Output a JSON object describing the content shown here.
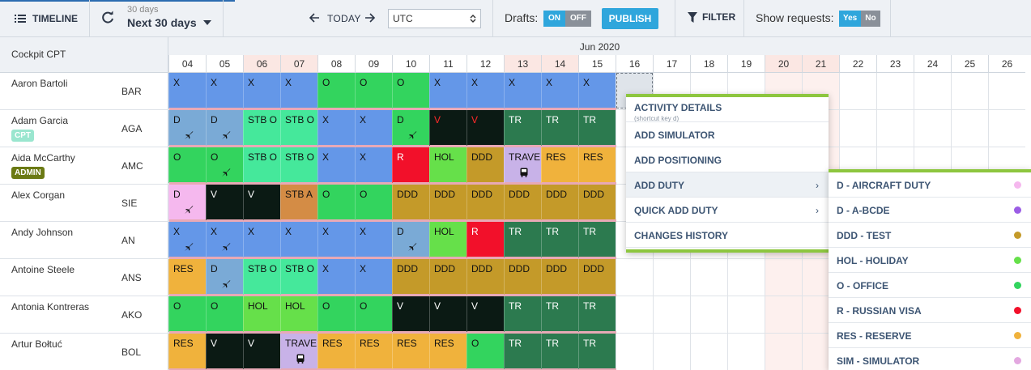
{
  "toolbar": {
    "timeline_label": "TIMELINE",
    "range_small": "30 days",
    "range_main": "Next 30 days",
    "today_label": "TODAY",
    "timezone": "UTC",
    "drafts_label": "Drafts:",
    "drafts_on": "ON",
    "drafts_off": "OFF",
    "publish_label": "PUBLISH",
    "filter_label": "FILTER",
    "show_requests_label": "Show requests:",
    "requests_yes": "Yes",
    "requests_no": "No"
  },
  "grid": {
    "corner_title": "Cockpit CPT",
    "month": "Jun 2020",
    "dates": [
      "04",
      "05",
      "06",
      "07",
      "08",
      "09",
      "10",
      "11",
      "12",
      "13",
      "14",
      "15",
      "16",
      "17",
      "18",
      "19",
      "20",
      "21",
      "22",
      "23",
      "24",
      "25",
      "26"
    ],
    "weekend_dates": [
      "06",
      "07",
      "13",
      "14",
      "20",
      "21"
    ]
  },
  "crew": [
    {
      "name": "Aaron Bartoli",
      "code": "BAR",
      "badge": "",
      "badge_color": ""
    },
    {
      "name": "Adam Garcia",
      "code": "AGA",
      "badge": "CPT",
      "badge_color": "#9ae6cf"
    },
    {
      "name": "Aida McCarthy",
      "code": "AMC",
      "badge": "ADMIN",
      "badge_color": "#6b7a14"
    },
    {
      "name": "Alex Corgan",
      "code": "SIE",
      "badge": "",
      "badge_color": ""
    },
    {
      "name": "Andy Johnson",
      "code": "AN",
      "badge": "",
      "badge_color": ""
    },
    {
      "name": "Antoine Steele",
      "code": "ANS",
      "badge": "",
      "badge_color": ""
    },
    {
      "name": "Antonia Kontreras",
      "code": "AKO",
      "badge": "",
      "badge_color": ""
    },
    {
      "name": "Artur Bołtuć",
      "code": "BOL",
      "badge": "",
      "badge_color": ""
    }
  ],
  "duty_colors": {
    "X": "#6497e8",
    "O": "#33d45e",
    "D": "#7aaad6",
    "DP": "#f5b8ee",
    "STB O": "#45e89b",
    "STB A": "#d48c45",
    "V": "#0b1a14",
    "R": "#f2102a",
    "HOL": "#66e04a",
    "DDD": "#c49a29",
    "TRAVEL": "#c8b2e8",
    "RES": "#f0b23c",
    "TR": "#2c7a4f"
  },
  "roster": [
    [
      {
        "c": "X"
      },
      {
        "c": "X"
      },
      {
        "c": "X"
      },
      {
        "c": "X"
      },
      {
        "c": "O"
      },
      {
        "c": "O"
      },
      {
        "c": "O"
      },
      {
        "c": "X"
      },
      {
        "c": "X"
      },
      {
        "c": "X"
      },
      {
        "c": "X"
      },
      {
        "c": "X"
      }
    ],
    [
      {
        "c": "D",
        "i": "plane"
      },
      {
        "c": "D",
        "i": "plane"
      },
      {
        "c": "STB O"
      },
      {
        "c": "STB O"
      },
      {
        "c": "X"
      },
      {
        "c": "X"
      },
      {
        "c": "D",
        "i": "plane",
        "k": "O"
      },
      {
        "c": "V",
        "t": "red"
      },
      {
        "c": "V",
        "t": "red"
      },
      {
        "c": "TR"
      },
      {
        "c": "TR"
      },
      {
        "c": "TR"
      }
    ],
    [
      {
        "c": "O"
      },
      {
        "c": "O",
        "i": "plane"
      },
      {
        "c": "STB O"
      },
      {
        "c": "STB O"
      },
      {
        "c": "X"
      },
      {
        "c": "X"
      },
      {
        "c": "R"
      },
      {
        "c": "HOL"
      },
      {
        "c": "DDD"
      },
      {
        "c": "TRAVEL",
        "i": "bus"
      },
      {
        "c": "RES"
      },
      {
        "c": "RES"
      }
    ],
    [
      {
        "c": "D",
        "i": "plane",
        "k": "DP"
      },
      {
        "c": "V"
      },
      {
        "c": "V"
      },
      {
        "c": "STB A"
      },
      {
        "c": "O"
      },
      {
        "c": "O"
      },
      {
        "c": "DDD"
      },
      {
        "c": "DDD"
      },
      {
        "c": "DDD"
      },
      {
        "c": "DDD"
      },
      {
        "c": "DDD"
      },
      {
        "c": "DDD"
      }
    ],
    [
      {
        "c": "X",
        "i": "plane"
      },
      {
        "c": "X",
        "i": "plane"
      },
      {
        "c": "X"
      },
      {
        "c": "X"
      },
      {
        "c": "X"
      },
      {
        "c": "X"
      },
      {
        "c": "D",
        "i": "plane"
      },
      {
        "c": "HOL"
      },
      {
        "c": "R"
      },
      {
        "c": "TR"
      },
      {
        "c": "TR"
      },
      {
        "c": "TR"
      }
    ],
    [
      {
        "c": "RES"
      },
      {
        "c": "D",
        "i": "plane"
      },
      {
        "c": "STB O"
      },
      {
        "c": "STB O"
      },
      {
        "c": "X"
      },
      {
        "c": "X"
      },
      {
        "c": "DDD"
      },
      {
        "c": "DDD"
      },
      {
        "c": "DDD"
      },
      {
        "c": "DDD"
      },
      {
        "c": "DDD"
      },
      {
        "c": "DDD"
      }
    ],
    [
      {
        "c": "O"
      },
      {
        "c": "O"
      },
      {
        "c": "HOL"
      },
      {
        "c": "HOL"
      },
      {
        "c": "O"
      },
      {
        "c": "O"
      },
      {
        "c": "V"
      },
      {
        "c": "V"
      },
      {
        "c": "V"
      },
      {
        "c": "TR"
      },
      {
        "c": "TR"
      },
      {
        "c": "TR"
      }
    ],
    [
      {
        "c": "RES"
      },
      {
        "c": "V"
      },
      {
        "c": "V"
      },
      {
        "c": "TRAVEL",
        "i": "bus"
      },
      {
        "c": "RES"
      },
      {
        "c": "RES"
      },
      {
        "c": "RES"
      },
      {
        "c": "RES"
      },
      {
        "c": "O"
      },
      {
        "c": "TR"
      },
      {
        "c": "TR"
      },
      {
        "c": "TR"
      }
    ]
  ],
  "context_menu": {
    "items": [
      {
        "label": "ACTIVITY DETAILS",
        "sub": "(shortcut key d)",
        "arrow": ""
      },
      {
        "label": "ADD SIMULATOR",
        "sub": "",
        "arrow": ""
      },
      {
        "label": "ADD POSITIONING",
        "sub": "",
        "arrow": ""
      },
      {
        "label": "ADD DUTY",
        "sub": "",
        "arrow": "›"
      },
      {
        "label": "QUICK ADD DUTY",
        "sub": "",
        "arrow": "›"
      },
      {
        "label": "CHANGES HISTORY",
        "sub": "",
        "arrow": ""
      }
    ]
  },
  "duty_submenu": {
    "items": [
      {
        "label": "D - AIRCRAFT DUTY",
        "color": "#f5b8ee"
      },
      {
        "label": "D - A-BCDE",
        "color": "#9b5de5"
      },
      {
        "label": "DDD - TEST",
        "color": "#c49a29"
      },
      {
        "label": "HOL - HOLIDAY",
        "color": "#66e04a"
      },
      {
        "label": "O - OFFICE",
        "color": "#33d45e"
      },
      {
        "label": "R - RUSSIAN VISA",
        "color": "#f2102a"
      },
      {
        "label": "RES - RESERVE",
        "color": "#f0b23c"
      },
      {
        "label": "SIM - SIMULATOR",
        "color": "#e3a8e0"
      }
    ]
  }
}
